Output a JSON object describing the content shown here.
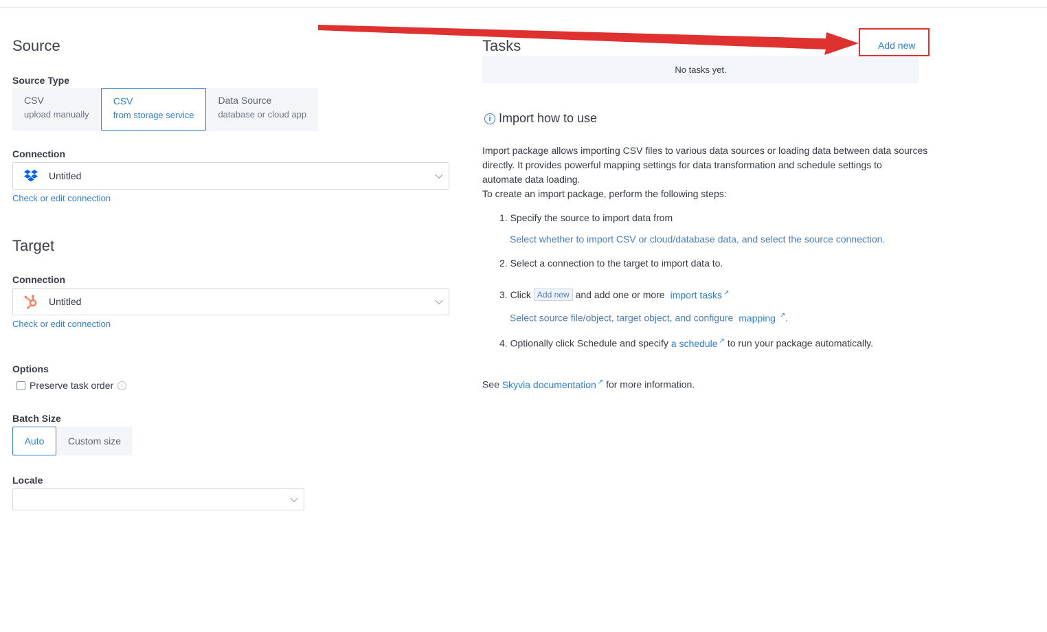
{
  "source": {
    "heading": "Source",
    "source_type_label": "Source Type",
    "types": [
      {
        "title": "CSV",
        "subtitle": "upload manually"
      },
      {
        "title": "CSV",
        "subtitle": "from storage service"
      },
      {
        "title": "Data Source",
        "subtitle": "database or cloud app"
      }
    ],
    "connection_label": "Connection",
    "connection_value": "Untitled",
    "check_link": "Check or edit connection"
  },
  "target": {
    "heading": "Target",
    "connection_label": "Connection",
    "connection_value": "Untitled",
    "check_link": "Check or edit connection"
  },
  "options": {
    "label": "Options",
    "preserve_order": "Preserve task order"
  },
  "batch": {
    "label": "Batch Size",
    "auto": "Auto",
    "custom": "Custom size"
  },
  "locale": {
    "label": "Locale",
    "value": ""
  },
  "tasks": {
    "heading": "Tasks",
    "add_new": "Add new",
    "empty": "No tasks yet."
  },
  "howto": {
    "heading": "Import how to use",
    "intro_1": "Import package allows importing CSV files to various data sources or loading data between data sources",
    "intro_2": "directly. It provides powerful mapping settings for data transformation and schedule settings to",
    "intro_3": "automate data loading.",
    "intro_4": "To create an import package, perform the following steps:",
    "step1": "1. Specify the source to import data from",
    "step1_sub": "Select whether to import CSV or cloud/database data, and select the source connection.",
    "step2": "2. Select a connection to the target to import data to.",
    "step3_a": "3. Click",
    "step3_chip": "Add new",
    "step3_b": "and add one or more",
    "step3_link": "import tasks",
    "step3_sub_a": "Select source file/object, target object, and configure",
    "step3_sub_link": "mapping",
    "step3_sub_end": ".",
    "step4_a": "4. Optionally click Schedule and specify",
    "step4_link": "a schedule",
    "step4_b": "to run your package automatically.",
    "see_a": "See",
    "see_link": "Skyvia documentation",
    "see_b": "for more information."
  },
  "colors": {
    "accent": "#2f7fd1",
    "annotation": "#e03131"
  }
}
